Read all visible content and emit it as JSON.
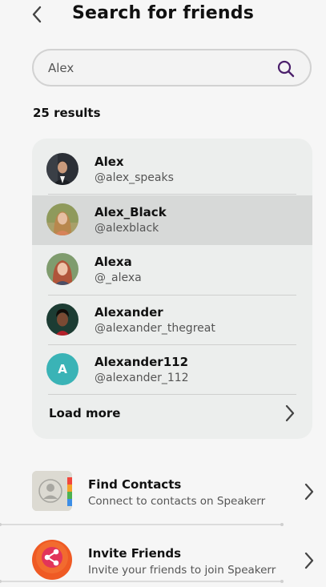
{
  "header": {
    "title": "Search for friends",
    "back_icon": "chevron-left-icon"
  },
  "search": {
    "value": "Alex",
    "icon": "search-icon"
  },
  "results": {
    "count_label": "25 results",
    "items": [
      {
        "name": "Alex",
        "handle": "@alex_speaks",
        "avatar": "photo"
      },
      {
        "name": "Alex_Black",
        "handle": "@alexblack",
        "avatar": "photo",
        "selected": true
      },
      {
        "name": "Alexa",
        "handle": "@_alexa",
        "avatar": "photo"
      },
      {
        "name": "Alexander",
        "handle": "@alexander_thegreat",
        "avatar": "photo"
      },
      {
        "name": "Alexander112",
        "handle": "@alexander_112",
        "avatar": "initial",
        "initial": "A"
      }
    ],
    "load_more_label": "Load more"
  },
  "actions": {
    "find_contacts": {
      "title": "Find Contacts",
      "subtitle": "Connect to contacts on Speakerr",
      "icon": "contacts-icon"
    },
    "invite_friends": {
      "title": "Invite Friends",
      "subtitle": "Invite your friends to join Speakerr",
      "icon": "share-icon"
    }
  },
  "colors": {
    "background": "#f6f6f6",
    "card": "#eceeed",
    "selected_row": "#d7d9d8",
    "avatar_teal": "#3ab3b6",
    "search_icon": "#4b1f6b",
    "share_orange": "#ef5a24"
  }
}
